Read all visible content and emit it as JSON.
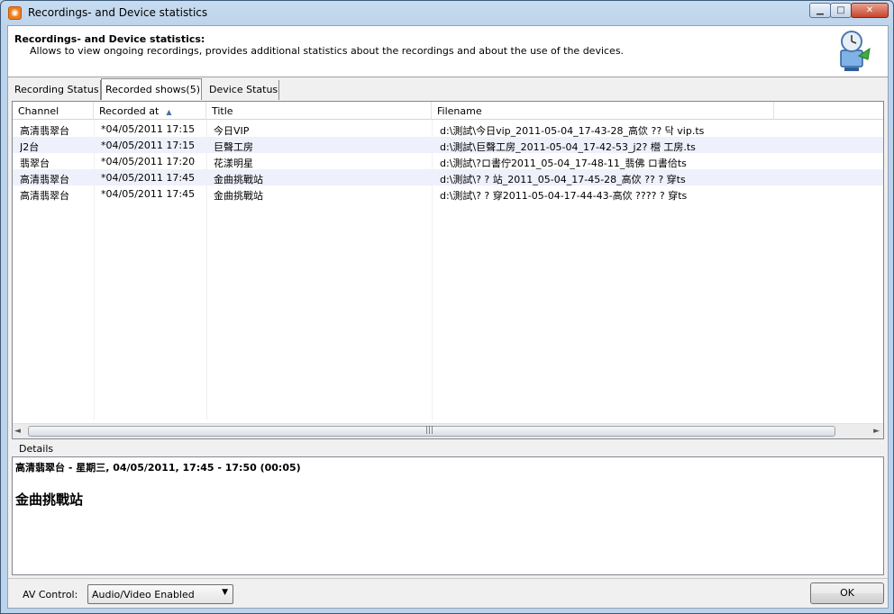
{
  "window": {
    "title": "Recordings- and Device statistics"
  },
  "header": {
    "title": "Recordings- and Device statistics:",
    "description": "Allows to view ongoing recordings, provides additional statistics about the recordings and about the use of the devices."
  },
  "tabs": [
    {
      "label": "Recording Status",
      "selected": false
    },
    {
      "label": "Recorded shows(5)",
      "selected": true
    },
    {
      "label": "Device Status",
      "selected": false
    }
  ],
  "columns": {
    "channel": "Channel",
    "recorded_at": "Recorded at",
    "title": "Title",
    "filename": "Filename"
  },
  "rows": [
    {
      "channel": "高清翡翠台",
      "recorded_at": "*04/05/2011 17:15",
      "title": "今日VIP",
      "filename": "d:\\測試\\今日vip_2011-05-04_17-43-28_高佽 ?? 닥 vip.ts"
    },
    {
      "channel": "J2台",
      "recorded_at": "*04/05/2011 17:15",
      "title": "巨聲工房",
      "filename": "d:\\測試\\巨聲工房_2011-05-04_17-42-53_j2? 櫿 工房.ts"
    },
    {
      "channel": "翡翠台",
      "recorded_at": "*04/05/2011 17:20",
      "title": "花漾明星",
      "filename": "d:\\測試\\?ロ書佇2011_05-04_17-48-11_翡佛 ロ書佮ts"
    },
    {
      "channel": "高清翡翠台",
      "recorded_at": "*04/05/2011 17:45",
      "title": "金曲挑戰站",
      "filename": "d:\\測試\\? ? 站_2011_05-04_17-45-28_高佽 ?? ? 穿ts"
    },
    {
      "channel": "高清翡翠台",
      "recorded_at": "*04/05/2011 17:45",
      "title": "金曲挑戰站",
      "filename": "d:\\測試\\? ? 穿2011-05-04-17-44-43-高佽 ???? ? 穿ts"
    }
  ],
  "details": {
    "label": "Details",
    "line1": "高清翡翠台 - 星期三, 04/05/2011, 17:45 - 17:50  (00:05)",
    "line2": "金曲挑戰站"
  },
  "bottom": {
    "av_label": "AV Control:",
    "av_value": "Audio/Video Enabled",
    "ok_label": "OK"
  },
  "icons": {
    "app": "rss-feed-icon",
    "header": "clock-monitor-icon"
  }
}
